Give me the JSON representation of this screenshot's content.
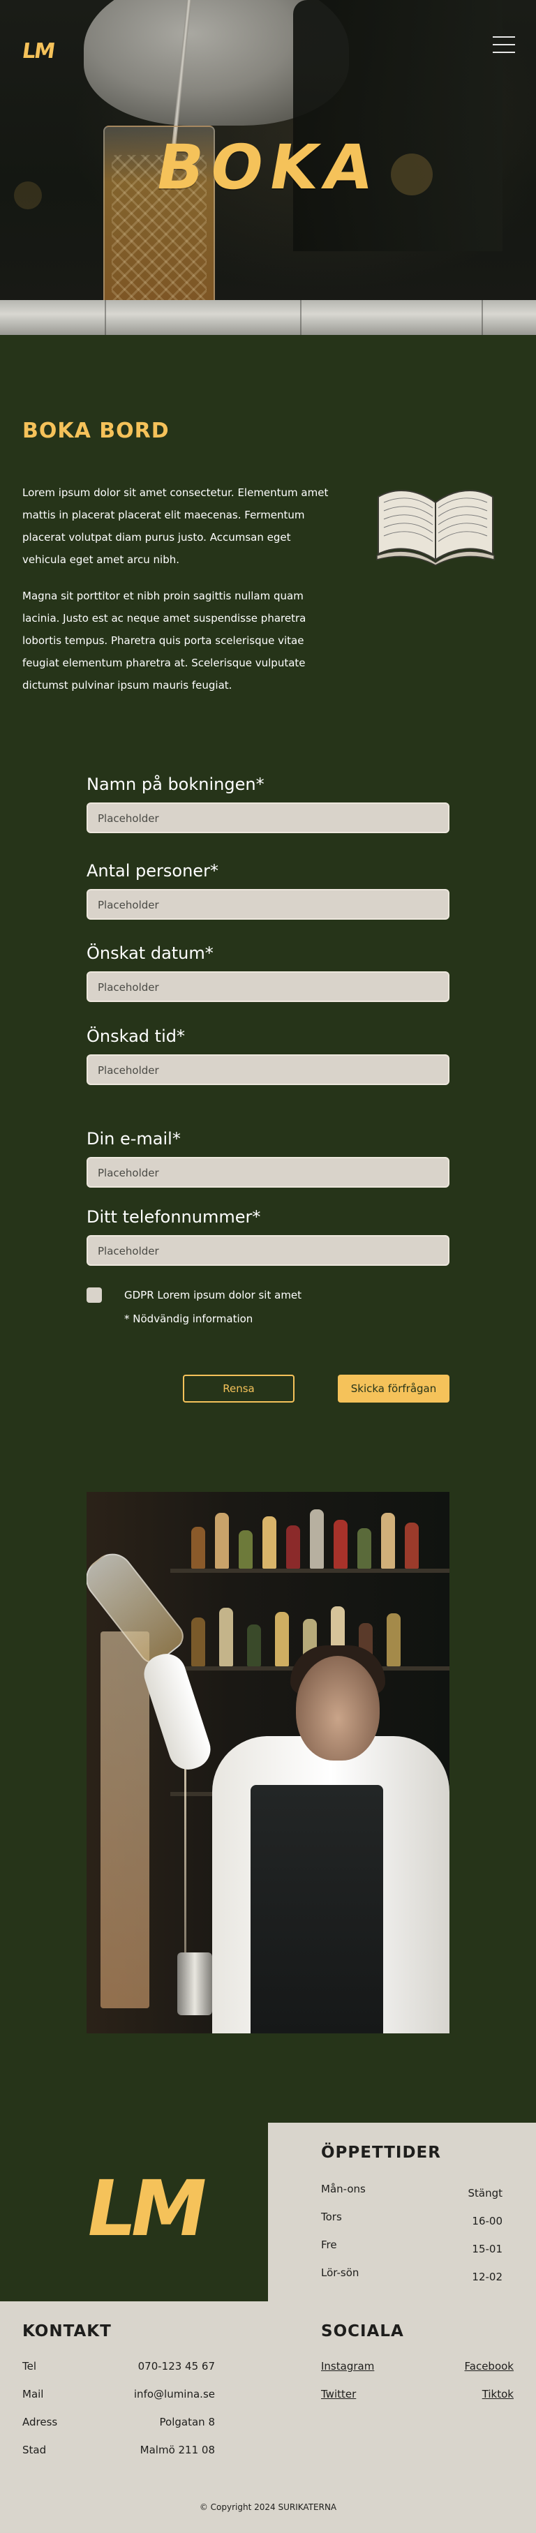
{
  "header": {
    "logo_text": "LM",
    "menu_icon": "hamburger-icon",
    "hero_title": "BOKA"
  },
  "booking": {
    "title": "BOKA BORD",
    "paragraph1": "Lorem ipsum dolor sit amet consectetur. Elementum amet mattis in placerat placerat elit maecenas. Fermentum placerat volutpat diam purus justo. Accumsan eget vehicula eget amet arcu nibh.",
    "paragraph2": "Magna sit porttitor et nibh proin sagittis nullam quam lacinia. Justo est ac neque amet suspendisse pharetra lobortis tempus. Pharetra quis porta scelerisque vitae feugiat elementum pharetra at. Scelerisque vulputate dictumst pulvinar ipsum mauris feugiat.",
    "illustration": "open-book-icon"
  },
  "form": {
    "fields": [
      {
        "label": "Namn på bokningen*",
        "placeholder": "Placeholder"
      },
      {
        "label": "Antal personer*",
        "placeholder": "Placeholder"
      },
      {
        "label": "Önskat datum*",
        "placeholder": "Placeholder"
      },
      {
        "label": "Önskad tid*",
        "placeholder": "Placeholder"
      },
      {
        "label": "Din e-mail*",
        "placeholder": "Placeholder"
      },
      {
        "label": "Ditt telefonnummer*",
        "placeholder": "Placeholder"
      }
    ],
    "gdpr_label": "GDPR Lorem ipsum dolor sit amet",
    "required_note": "* Nödvändig information",
    "reset_label": "Rensa",
    "submit_label": "Skicka förfrågan"
  },
  "footer": {
    "logo_text": "LM",
    "hours": {
      "title": "ÖPPETTIDER",
      "rows": [
        {
          "day": "Mån-ons",
          "value": "Stängt"
        },
        {
          "day": "Tors",
          "value": "16-00"
        },
        {
          "day": "Fre",
          "value": "15-01"
        },
        {
          "day": "Lör-sön",
          "value": "12-02"
        }
      ]
    },
    "contact": {
      "title": "KONTAKT",
      "rows": [
        {
          "label": "Tel",
          "value": "070-123 45 67"
        },
        {
          "label": "Mail",
          "value": "info@lumina.se"
        },
        {
          "label": "Adress",
          "value": "Polgatan 8"
        },
        {
          "label": "Stad",
          "value": "Malmö 211 08"
        }
      ]
    },
    "social": {
      "title": "SOCIALA",
      "links": [
        {
          "label": "Instagram"
        },
        {
          "label": "Facebook"
        },
        {
          "label": "Twitter"
        },
        {
          "label": "Tiktok"
        }
      ]
    },
    "copyright": "© Copyright 2024 SURIKATERNA"
  },
  "colors": {
    "background": "#263419",
    "accent": "#f5c25a",
    "footer_light": "#d9d5cc",
    "input_bg": "#d9d3ca"
  }
}
